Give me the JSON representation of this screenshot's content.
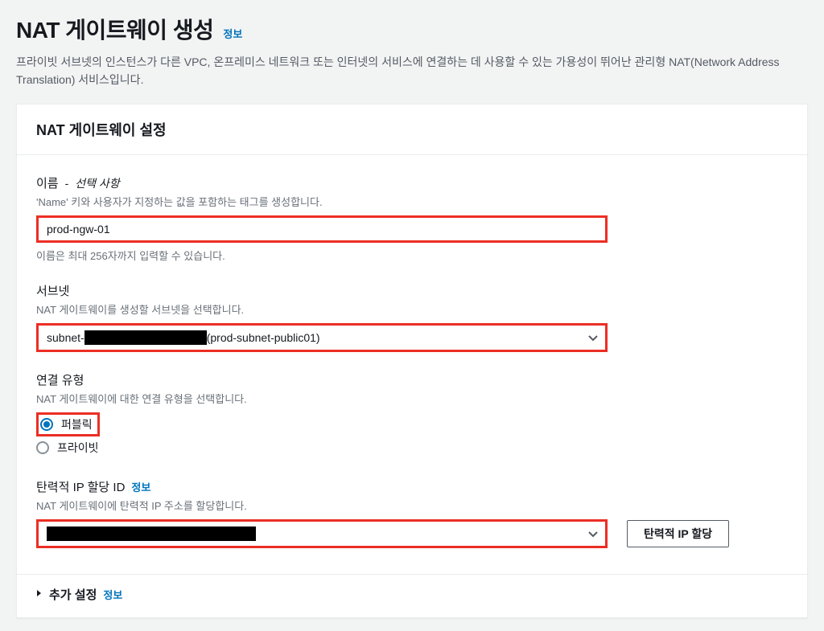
{
  "header": {
    "title": "NAT 게이트웨이 생성",
    "info": "정보",
    "description": "프라이빗 서브넷의 인스턴스가 다른 VPC, 온프레미스 네트워크 또는 인터넷의 서비스에 연결하는 데 사용할 수 있는 가용성이 뛰어난 관리형 NAT(Network Address Translation) 서비스입니다."
  },
  "panel": {
    "title": "NAT 게이트웨이 설정"
  },
  "name": {
    "label": "이름",
    "optional": "선택 사항",
    "description": "'Name' 키와 사용자가 지정하는 값을 포함하는 태그를 생성합니다.",
    "value": "prod-ngw-01",
    "help": "이름은 최대 256자까지 입력할 수 있습니다."
  },
  "subnet": {
    "label": "서브넷",
    "description": "NAT 게이트웨이를 생성할 서브넷을 선택합니다.",
    "prefix": "subnet-",
    "suffix": "(prod-subnet-public01)"
  },
  "connectivity": {
    "label": "연결 유형",
    "description": "NAT 게이트웨이에 대한 연결 유형을 선택합니다.",
    "options": {
      "public": "퍼블릭",
      "private": "프라이빗"
    },
    "selected": "public"
  },
  "eip": {
    "label": "탄력적 IP 할당 ID",
    "info": "정보",
    "description": "NAT 게이트웨이에 탄력적 IP 주소를 할당합니다.",
    "allocate_button": "탄력적 IP 할당"
  },
  "expand": {
    "label": "추가 설정",
    "info": "정보"
  }
}
